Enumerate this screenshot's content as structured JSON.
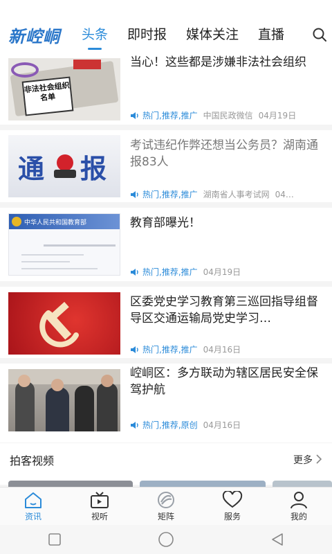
{
  "app": {
    "logo_text": "新崆峒"
  },
  "tabs": [
    {
      "label": "头条",
      "active": true
    },
    {
      "label": "即时报",
      "active": false
    },
    {
      "label": "媒体关注",
      "active": false
    },
    {
      "label": "直播",
      "active": false
    }
  ],
  "search": {
    "icon": "search-icon"
  },
  "news": [
    {
      "title": "当心！这些都是涉嫌非法社会组织",
      "tags": "热门,推荐,推广",
      "source": "中国民政微信",
      "date": "04月19日",
      "thumb_text": "非法社会组织名单",
      "title_read": false
    },
    {
      "title": "考试违纪作弊还想当公务员？湖南通报83人",
      "tags": "热门,推荐,推广",
      "source": "湖南省人事考试网",
      "date": "04…",
      "thumb_text_left": "通",
      "thumb_text_right": "报",
      "title_read": true
    },
    {
      "title": "教育部曝光！",
      "tags": "热门,推荐,推广",
      "source": "",
      "date": "04月19日",
      "thumb_header": "中华人民共和国教育部",
      "title_read": false
    },
    {
      "title": "区委党史学习教育第三巡回指导组督导区交通运输局党史学习…",
      "tags": "热门,推荐,推广",
      "source": "",
      "date": "04月16日",
      "title_read": false
    },
    {
      "title": "崆峒区：多方联动为辖区居民安全保驾护航",
      "tags": "热门,推荐,原创",
      "source": "",
      "date": "04月16日",
      "title_read": false
    }
  ],
  "video_section": {
    "title": "拍客视频",
    "more_label": "更多"
  },
  "bottom_nav": [
    {
      "label": "资讯",
      "icon": "home-icon",
      "active": true
    },
    {
      "label": "视听",
      "icon": "tv-icon",
      "active": false
    },
    {
      "label": "矩阵",
      "icon": "matrix-logo-icon",
      "active": false
    },
    {
      "label": "服务",
      "icon": "heart-icon",
      "active": false
    },
    {
      "label": "我的",
      "icon": "user-icon",
      "active": false
    }
  ],
  "colors": {
    "accent": "#2b8bd9",
    "logo": "#2a76c9",
    "text": "#222222",
    "meta": "#999999"
  }
}
